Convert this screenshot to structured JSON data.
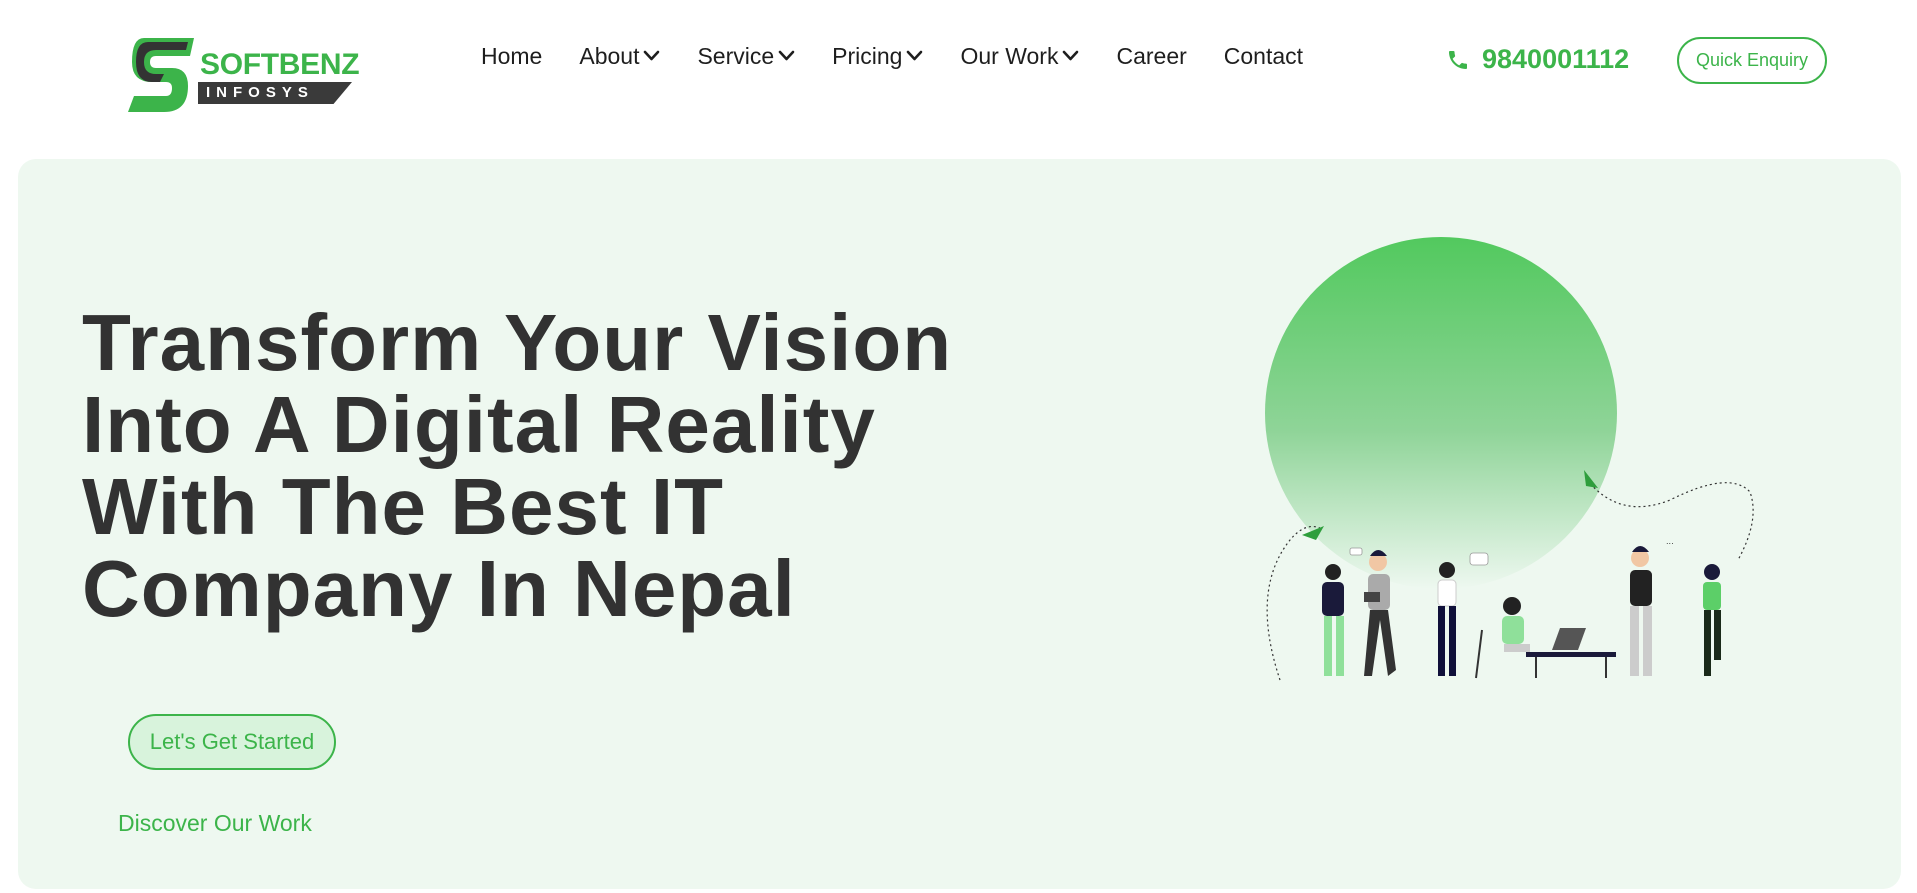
{
  "brand": {
    "name": "SOFTBENZ",
    "subtitle": "INFOSYS",
    "colors": {
      "accent": "#3cb44a",
      "dark": "#333333",
      "hero_bg": "#eef8f0",
      "cta_bg": "#d8f3dc"
    }
  },
  "nav": {
    "items": [
      {
        "label": "Home",
        "has_dropdown": false
      },
      {
        "label": "About",
        "has_dropdown": true
      },
      {
        "label": "Service",
        "has_dropdown": true
      },
      {
        "label": "Pricing",
        "has_dropdown": true
      },
      {
        "label": "Our Work",
        "has_dropdown": true
      },
      {
        "label": "Career",
        "has_dropdown": false
      },
      {
        "label": "Contact",
        "has_dropdown": false
      }
    ],
    "dropdown_icon": "chevron-down-icon"
  },
  "contact": {
    "phone_icon": "phone-icon",
    "phone": "9840001112"
  },
  "header": {
    "enquiry_label": "Quick Enquiry"
  },
  "hero": {
    "headline_lines": [
      "Transform Your Vision",
      "Into A Digital Reality",
      "With The Best IT",
      "Company In Nepal"
    ],
    "cta_label": "Let's Get Started",
    "secondary_link": "Discover Our Work",
    "illustration": "team-collaboration-illustration"
  }
}
